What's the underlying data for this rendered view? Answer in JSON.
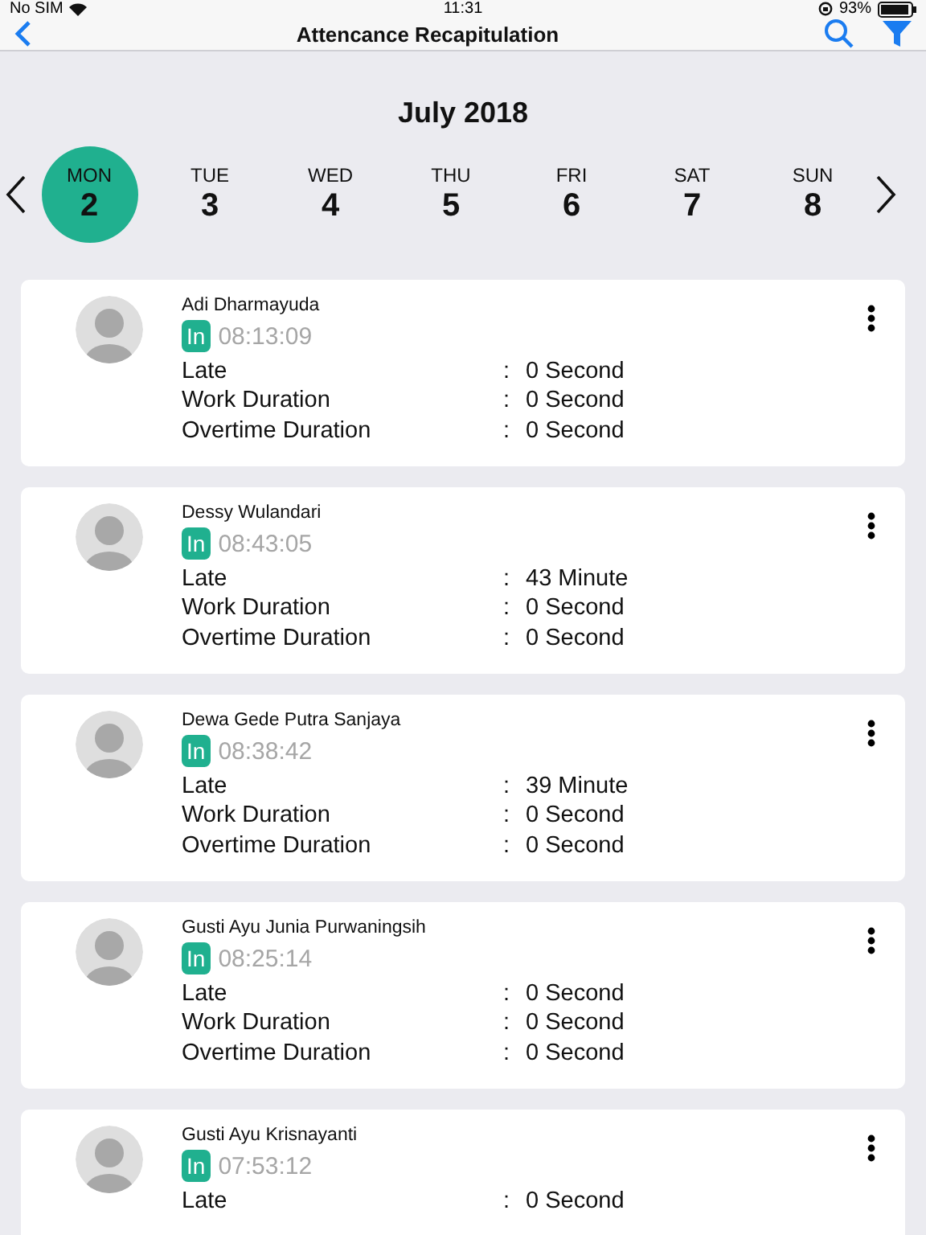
{
  "status_bar": {
    "carrier": "No SIM",
    "time": "11:31",
    "battery": "93%"
  },
  "nav": {
    "title": "Attencance Recapitulation"
  },
  "month": "July 2018",
  "days": [
    {
      "weekday": "MON",
      "date": "2",
      "selected": true
    },
    {
      "weekday": "TUE",
      "date": "3",
      "selected": false
    },
    {
      "weekday": "WED",
      "date": "4",
      "selected": false
    },
    {
      "weekday": "THU",
      "date": "5",
      "selected": false
    },
    {
      "weekday": "FRI",
      "date": "6",
      "selected": false
    },
    {
      "weekday": "SAT",
      "date": "7",
      "selected": false
    },
    {
      "weekday": "SUN",
      "date": "8",
      "selected": false
    }
  ],
  "employees": [
    {
      "name": "Adi Dharmayuda",
      "badge": "In",
      "time": "08:13:09",
      "rows": [
        {
          "label": "Late",
          "separator": ":",
          "value": "0 Second"
        },
        {
          "label": "Work Duration",
          "separator": ":",
          "value": "0 Second"
        },
        {
          "label": "Overtime Duration",
          "separator": ":",
          "value": "0 Second"
        }
      ]
    },
    {
      "name": "Dessy Wulandari",
      "badge": "In",
      "time": "08:43:05",
      "rows": [
        {
          "label": "Late",
          "separator": ":",
          "value": "43 Minute"
        },
        {
          "label": "Work Duration",
          "separator": ":",
          "value": "0 Second"
        },
        {
          "label": "Overtime Duration",
          "separator": ":",
          "value": "0 Second"
        }
      ]
    },
    {
      "name": "Dewa Gede Putra Sanjaya",
      "badge": "In",
      "time": "08:38:42",
      "rows": [
        {
          "label": "Late",
          "separator": ":",
          "value": "39 Minute"
        },
        {
          "label": "Work Duration",
          "separator": ":",
          "value": "0 Second"
        },
        {
          "label": "Overtime Duration",
          "separator": ":",
          "value": "0 Second"
        }
      ]
    },
    {
      "name": "Gusti Ayu Junia Purwaningsih",
      "badge": "In",
      "time": "08:25:14",
      "rows": [
        {
          "label": "Late",
          "separator": ":",
          "value": "0 Second"
        },
        {
          "label": "Work Duration",
          "separator": ":",
          "value": "0 Second"
        },
        {
          "label": "Overtime Duration",
          "separator": ":",
          "value": "0 Second"
        }
      ]
    },
    {
      "name": "Gusti Ayu Krisnayanti",
      "badge": "In",
      "time": "07:53:12",
      "rows": [
        {
          "label": "Late",
          "separator": ":",
          "value": "0 Second"
        }
      ]
    }
  ]
}
